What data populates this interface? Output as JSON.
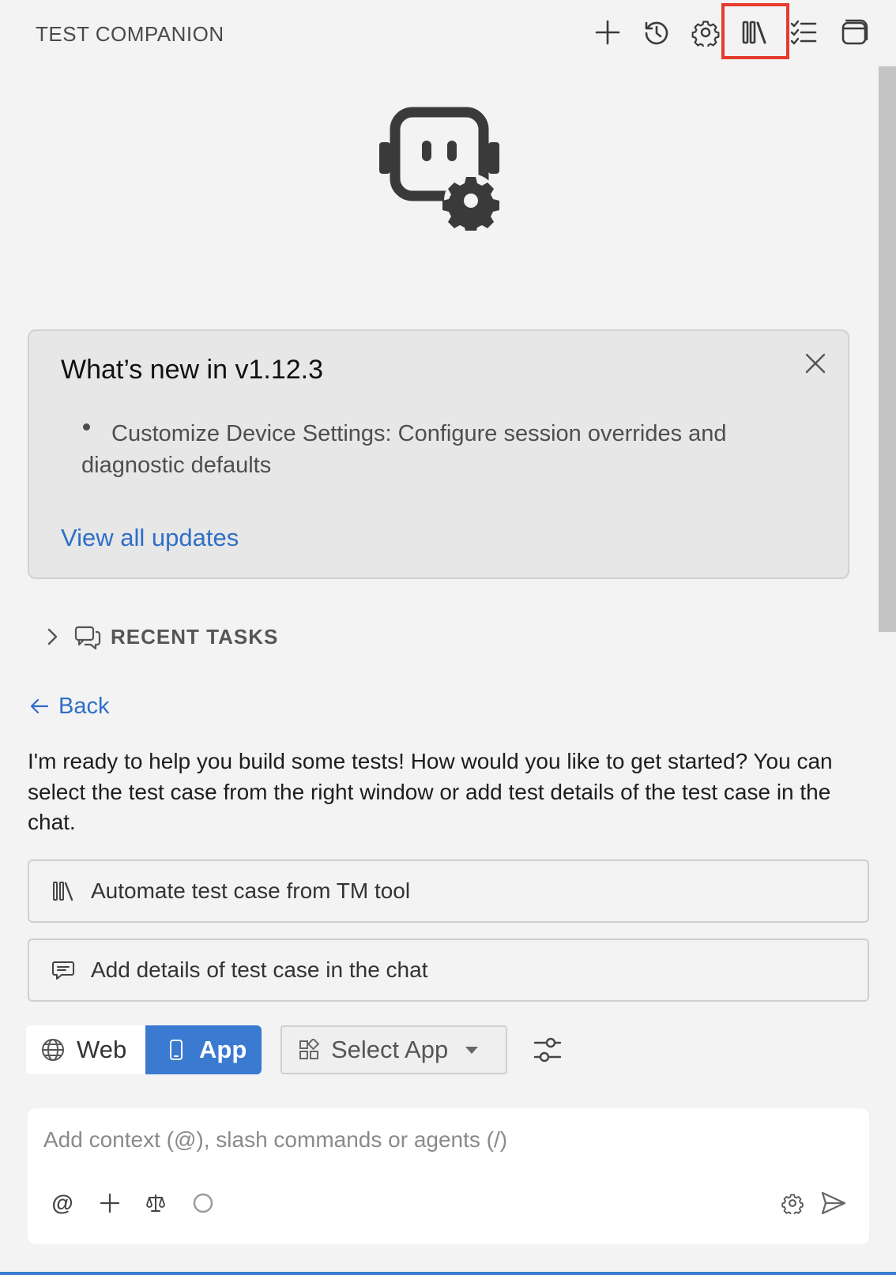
{
  "header": {
    "title": "TEST COMPANION",
    "toolbar": [
      {
        "icon": "plus-icon",
        "tooltip": "New"
      },
      {
        "icon": "history-icon",
        "tooltip": "History"
      },
      {
        "icon": "gear-icon",
        "tooltip": "Settings"
      },
      {
        "icon": "library-icon",
        "tooltip": "Test management"
      },
      {
        "icon": "checklist-icon",
        "tooltip": "Tasks"
      },
      {
        "icon": "panel-icon",
        "tooltip": "Panel"
      }
    ],
    "highlight_color": "#e53b2c"
  },
  "news": {
    "title": "What’s new in v1.12.3",
    "items": [
      "Customize Device Settings: Configure session overrides and diagnostic defaults"
    ],
    "link": "View all updates"
  },
  "recent_tasks": {
    "label": "RECENT TASKS",
    "expanded": false
  },
  "back": {
    "label": "Back"
  },
  "intro": "I'm ready to help you build some tests! How would you like to get started? You can select the test case from the right window or add test details of the test case in the chat.",
  "options": [
    {
      "icon": "library-icon",
      "label": "Automate test case from TM tool"
    },
    {
      "icon": "chat-icon",
      "label": "Add details of test case in the chat"
    }
  ],
  "mode": {
    "web_label": "Web",
    "app_label": "App",
    "selected": "App",
    "accent": "#3a7ad0"
  },
  "select_app": {
    "label": "Select App"
  },
  "chat": {
    "placeholder": "Add context (@), slash commands or agents (/)",
    "value": "",
    "tools": {
      "mention": "@"
    }
  }
}
